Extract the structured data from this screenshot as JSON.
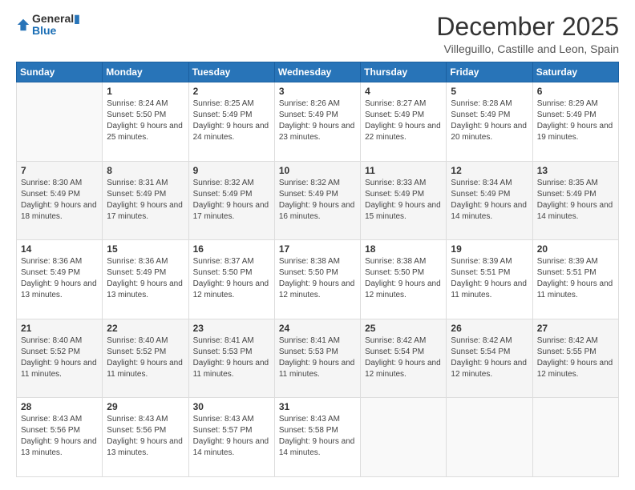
{
  "header": {
    "logo_line1": "General",
    "logo_line2": "Blue",
    "title": "December 2025",
    "subtitle": "Villeguillo, Castille and Leon, Spain"
  },
  "calendar": {
    "days_of_week": [
      "Sunday",
      "Monday",
      "Tuesday",
      "Wednesday",
      "Thursday",
      "Friday",
      "Saturday"
    ],
    "weeks": [
      [
        {
          "day": "",
          "sunrise": "",
          "sunset": "",
          "daylight": ""
        },
        {
          "day": "1",
          "sunrise": "Sunrise: 8:24 AM",
          "sunset": "Sunset: 5:50 PM",
          "daylight": "Daylight: 9 hours and 25 minutes."
        },
        {
          "day": "2",
          "sunrise": "Sunrise: 8:25 AM",
          "sunset": "Sunset: 5:49 PM",
          "daylight": "Daylight: 9 hours and 24 minutes."
        },
        {
          "day": "3",
          "sunrise": "Sunrise: 8:26 AM",
          "sunset": "Sunset: 5:49 PM",
          "daylight": "Daylight: 9 hours and 23 minutes."
        },
        {
          "day": "4",
          "sunrise": "Sunrise: 8:27 AM",
          "sunset": "Sunset: 5:49 PM",
          "daylight": "Daylight: 9 hours and 22 minutes."
        },
        {
          "day": "5",
          "sunrise": "Sunrise: 8:28 AM",
          "sunset": "Sunset: 5:49 PM",
          "daylight": "Daylight: 9 hours and 20 minutes."
        },
        {
          "day": "6",
          "sunrise": "Sunrise: 8:29 AM",
          "sunset": "Sunset: 5:49 PM",
          "daylight": "Daylight: 9 hours and 19 minutes."
        }
      ],
      [
        {
          "day": "7",
          "sunrise": "Sunrise: 8:30 AM",
          "sunset": "Sunset: 5:49 PM",
          "daylight": "Daylight: 9 hours and 18 minutes."
        },
        {
          "day": "8",
          "sunrise": "Sunrise: 8:31 AM",
          "sunset": "Sunset: 5:49 PM",
          "daylight": "Daylight: 9 hours and 17 minutes."
        },
        {
          "day": "9",
          "sunrise": "Sunrise: 8:32 AM",
          "sunset": "Sunset: 5:49 PM",
          "daylight": "Daylight: 9 hours and 17 minutes."
        },
        {
          "day": "10",
          "sunrise": "Sunrise: 8:32 AM",
          "sunset": "Sunset: 5:49 PM",
          "daylight": "Daylight: 9 hours and 16 minutes."
        },
        {
          "day": "11",
          "sunrise": "Sunrise: 8:33 AM",
          "sunset": "Sunset: 5:49 PM",
          "daylight": "Daylight: 9 hours and 15 minutes."
        },
        {
          "day": "12",
          "sunrise": "Sunrise: 8:34 AM",
          "sunset": "Sunset: 5:49 PM",
          "daylight": "Daylight: 9 hours and 14 minutes."
        },
        {
          "day": "13",
          "sunrise": "Sunrise: 8:35 AM",
          "sunset": "Sunset: 5:49 PM",
          "daylight": "Daylight: 9 hours and 14 minutes."
        }
      ],
      [
        {
          "day": "14",
          "sunrise": "Sunrise: 8:36 AM",
          "sunset": "Sunset: 5:49 PM",
          "daylight": "Daylight: 9 hours and 13 minutes."
        },
        {
          "day": "15",
          "sunrise": "Sunrise: 8:36 AM",
          "sunset": "Sunset: 5:49 PM",
          "daylight": "Daylight: 9 hours and 13 minutes."
        },
        {
          "day": "16",
          "sunrise": "Sunrise: 8:37 AM",
          "sunset": "Sunset: 5:50 PM",
          "daylight": "Daylight: 9 hours and 12 minutes."
        },
        {
          "day": "17",
          "sunrise": "Sunrise: 8:38 AM",
          "sunset": "Sunset: 5:50 PM",
          "daylight": "Daylight: 9 hours and 12 minutes."
        },
        {
          "day": "18",
          "sunrise": "Sunrise: 8:38 AM",
          "sunset": "Sunset: 5:50 PM",
          "daylight": "Daylight: 9 hours and 12 minutes."
        },
        {
          "day": "19",
          "sunrise": "Sunrise: 8:39 AM",
          "sunset": "Sunset: 5:51 PM",
          "daylight": "Daylight: 9 hours and 11 minutes."
        },
        {
          "day": "20",
          "sunrise": "Sunrise: 8:39 AM",
          "sunset": "Sunset: 5:51 PM",
          "daylight": "Daylight: 9 hours and 11 minutes."
        }
      ],
      [
        {
          "day": "21",
          "sunrise": "Sunrise: 8:40 AM",
          "sunset": "Sunset: 5:52 PM",
          "daylight": "Daylight: 9 hours and 11 minutes."
        },
        {
          "day": "22",
          "sunrise": "Sunrise: 8:40 AM",
          "sunset": "Sunset: 5:52 PM",
          "daylight": "Daylight: 9 hours and 11 minutes."
        },
        {
          "day": "23",
          "sunrise": "Sunrise: 8:41 AM",
          "sunset": "Sunset: 5:53 PM",
          "daylight": "Daylight: 9 hours and 11 minutes."
        },
        {
          "day": "24",
          "sunrise": "Sunrise: 8:41 AM",
          "sunset": "Sunset: 5:53 PM",
          "daylight": "Daylight: 9 hours and 11 minutes."
        },
        {
          "day": "25",
          "sunrise": "Sunrise: 8:42 AM",
          "sunset": "Sunset: 5:54 PM",
          "daylight": "Daylight: 9 hours and 12 minutes."
        },
        {
          "day": "26",
          "sunrise": "Sunrise: 8:42 AM",
          "sunset": "Sunset: 5:54 PM",
          "daylight": "Daylight: 9 hours and 12 minutes."
        },
        {
          "day": "27",
          "sunrise": "Sunrise: 8:42 AM",
          "sunset": "Sunset: 5:55 PM",
          "daylight": "Daylight: 9 hours and 12 minutes."
        }
      ],
      [
        {
          "day": "28",
          "sunrise": "Sunrise: 8:43 AM",
          "sunset": "Sunset: 5:56 PM",
          "daylight": "Daylight: 9 hours and 13 minutes."
        },
        {
          "day": "29",
          "sunrise": "Sunrise: 8:43 AM",
          "sunset": "Sunset: 5:56 PM",
          "daylight": "Daylight: 9 hours and 13 minutes."
        },
        {
          "day": "30",
          "sunrise": "Sunrise: 8:43 AM",
          "sunset": "Sunset: 5:57 PM",
          "daylight": "Daylight: 9 hours and 14 minutes."
        },
        {
          "day": "31",
          "sunrise": "Sunrise: 8:43 AM",
          "sunset": "Sunset: 5:58 PM",
          "daylight": "Daylight: 9 hours and 14 minutes."
        },
        {
          "day": "",
          "sunrise": "",
          "sunset": "",
          "daylight": ""
        },
        {
          "day": "",
          "sunrise": "",
          "sunset": "",
          "daylight": ""
        },
        {
          "day": "",
          "sunrise": "",
          "sunset": "",
          "daylight": ""
        }
      ]
    ]
  }
}
